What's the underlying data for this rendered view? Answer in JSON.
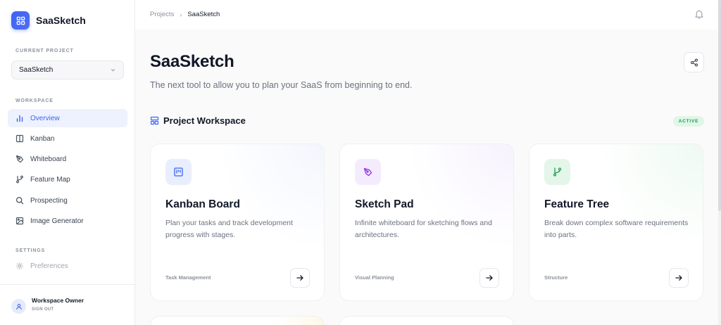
{
  "brand": {
    "name": "SaaSketch",
    "icon": "grid-icon",
    "accent": "#3b63f3"
  },
  "sidebar": {
    "current_project_label": "CURRENT PROJECT",
    "current_project_value": "SaaSketch",
    "workspace_label": "WORKSPACE",
    "items": [
      {
        "label": "Overview",
        "icon": "bar-chart-icon",
        "active": true
      },
      {
        "label": "Kanban",
        "icon": "columns-icon"
      },
      {
        "label": "Whiteboard",
        "icon": "pen-tool-icon"
      },
      {
        "label": "Feature Map",
        "icon": "git-branch-icon"
      },
      {
        "label": "Prospecting",
        "icon": "search-icon"
      },
      {
        "label": "Image Generator",
        "icon": "image-icon"
      }
    ],
    "settings_label": "SETTINGS",
    "settings_items": [
      {
        "label": "Preferences",
        "icon": "gear-icon",
        "disabled": true
      }
    ],
    "footer": {
      "name": "Workspace Owner",
      "action": "SIGN OUT"
    }
  },
  "breadcrumb": {
    "parent": "Projects",
    "current": "SaaSketch"
  },
  "page": {
    "title": "SaaSketch",
    "subtitle": "The next tool to allow you to plan your SaaS from beginning to end."
  },
  "workspace": {
    "title": "Project Workspace",
    "status": "ACTIVE",
    "status_color": "#1c9a4f"
  },
  "cards": [
    {
      "title": "Kanban Board",
      "description": "Plan your tasks and track development progress with stages.",
      "tag": "Task Management",
      "icon": "kanban-icon",
      "color": "#3b63f3"
    },
    {
      "title": "Sketch Pad",
      "description": "Infinite whiteboard for sketching flows and architectures.",
      "tag": "Visual Planning",
      "icon": "pen-tool-icon",
      "color": "#9333ea"
    },
    {
      "title": "Feature Tree",
      "description": "Break down complex software requirements into parts.",
      "tag": "Structure",
      "icon": "git-branch-icon",
      "color": "#16a34a"
    }
  ]
}
